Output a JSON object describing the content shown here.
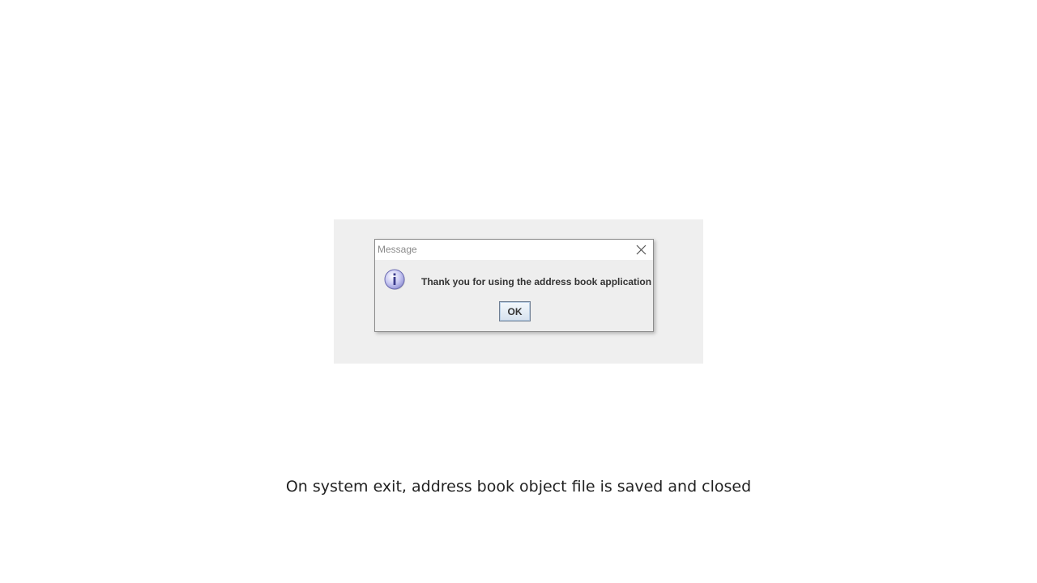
{
  "dialog": {
    "title": "Message",
    "message": "Thank you for using the address book application",
    "ok_label": "OK",
    "icon": "information-icon"
  },
  "caption": "On system exit, address book object file is saved and closed"
}
